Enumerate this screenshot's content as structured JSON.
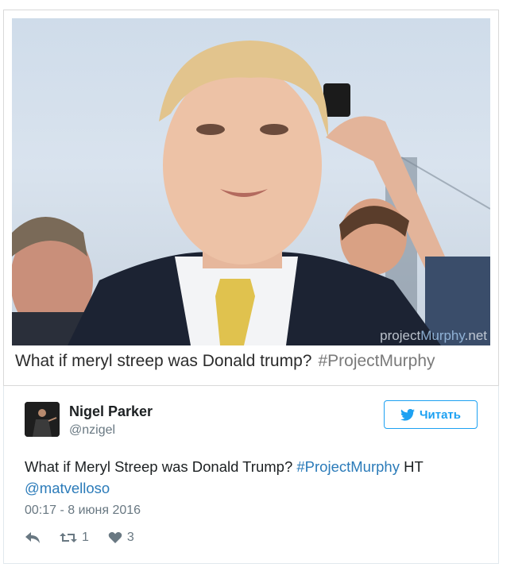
{
  "image": {
    "caption": "What if meryl streep was Donald trump?",
    "caption_tag": "#ProjectMurphy",
    "watermark_prefix": "project",
    "watermark_brand": "Murphy",
    "watermark_suffix": ".net"
  },
  "tweet": {
    "author_name": "Nigel Parker",
    "author_handle": "@nzigel",
    "follow_label": "Читать",
    "text_main": "What if Meryl Streep was Donald Trump?",
    "hashtag": "#ProjectMurphy",
    "text_ht": "HT",
    "mention": "@matvelloso",
    "timestamp": "00:17 - 8 июня 2016",
    "retweet_count": "1",
    "like_count": "3"
  },
  "icons": [
    "reply-icon",
    "retweet-icon",
    "heart-icon",
    "twitter-bird-icon"
  ],
  "colors": {
    "twitter_blue": "#1da1f2",
    "link": "#2b7bb9",
    "muted": "#697882"
  }
}
